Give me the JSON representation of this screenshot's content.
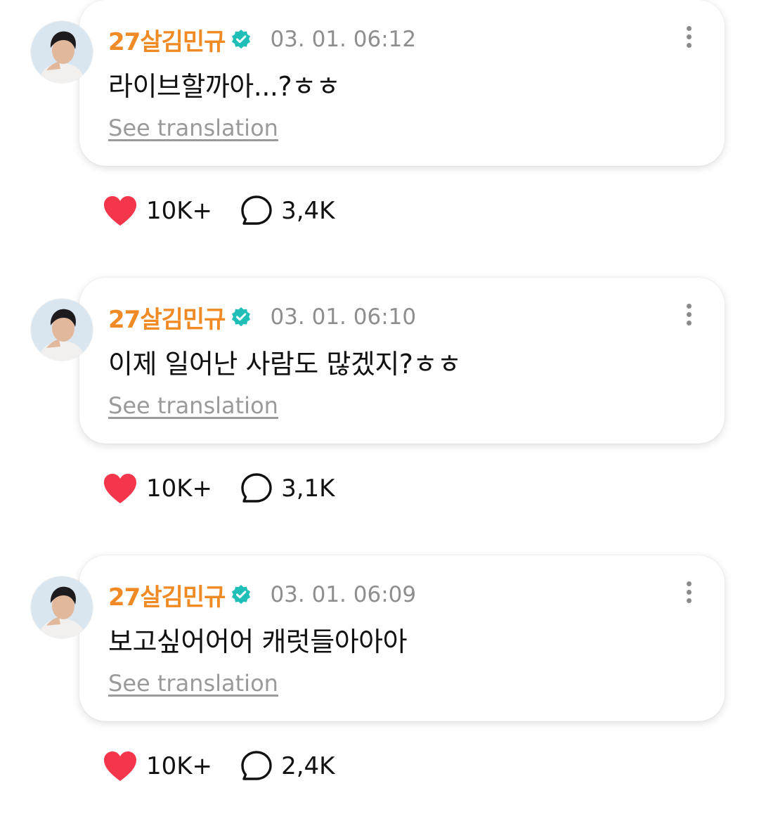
{
  "posts": [
    {
      "username": "27살김민규",
      "timestamp": "03. 01. 06:12",
      "text": "라이브할까아...?ㅎㅎ",
      "see_translation": "See translation",
      "likes": "10K+",
      "comments": "3,4K"
    },
    {
      "username": "27살김민규",
      "timestamp": "03. 01. 06:10",
      "text": "이제 일어난 사람도 많겠지?ㅎㅎ",
      "see_translation": "See translation",
      "likes": "10K+",
      "comments": "3,1K"
    },
    {
      "username": "27살김민규",
      "timestamp": "03. 01. 06:09",
      "text": "보고싶어어어 캐럿들아아아",
      "see_translation": "See translation",
      "likes": "10K+",
      "comments": "2,4K"
    }
  ],
  "icons": {
    "verified": "verified-badge-icon",
    "like": "heart-icon",
    "comment": "comment-bubble-icon",
    "menu": "more-vertical-icon"
  },
  "colors": {
    "username": "#f08a24",
    "verified": "#1fbfb8",
    "heart": "#f4364c",
    "timestamp": "#8e8e8e",
    "see_translation": "#9a9a9a"
  }
}
